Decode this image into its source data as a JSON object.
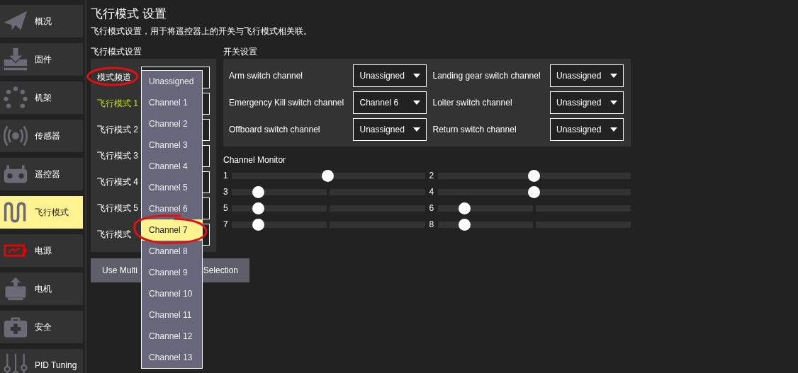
{
  "sidebar": {
    "items": [
      {
        "label": "概况",
        "selected": false
      },
      {
        "label": "固件",
        "selected": false
      },
      {
        "label": "机架",
        "selected": false
      },
      {
        "label": "传感器",
        "selected": false
      },
      {
        "label": "遥控器",
        "selected": false
      },
      {
        "label": "飞行模式",
        "selected": true
      },
      {
        "label": "电源",
        "selected": false
      },
      {
        "label": "电机",
        "selected": false
      },
      {
        "label": "安全",
        "selected": false
      },
      {
        "label": "PID Tuning",
        "selected": false
      }
    ]
  },
  "page": {
    "title": "飞行模式 设置",
    "description": "飞行模式设置，用于将遥控器上的开关与飞行模式相关联。"
  },
  "flight_modes": {
    "heading": "飞行模式设置",
    "mode_channel": {
      "label": "模式频道",
      "circled": true
    },
    "modes": [
      {
        "label": "飞行模式 1",
        "active": true
      },
      {
        "label": "飞行模式 2",
        "active": false
      },
      {
        "label": "飞行模式 3",
        "active": false
      },
      {
        "label": "飞行模式 4",
        "active": false
      },
      {
        "label": "飞行模式 5",
        "active": false
      },
      {
        "label": "飞行模式",
        "active": false
      }
    ]
  },
  "dropdown": {
    "options": [
      {
        "label": "Unassigned",
        "selected": false,
        "circled": false
      },
      {
        "label": "Channel 1",
        "selected": false,
        "circled": false
      },
      {
        "label": "Channel 2",
        "selected": false,
        "circled": false
      },
      {
        "label": "Channel 3",
        "selected": false,
        "circled": false
      },
      {
        "label": "Channel 4",
        "selected": false,
        "circled": false
      },
      {
        "label": "Channel 5",
        "selected": false,
        "circled": false
      },
      {
        "label": "Channel 6",
        "selected": false,
        "circled": false
      },
      {
        "label": "Channel 7",
        "selected": true,
        "circled": true
      },
      {
        "label": "Channel 8",
        "selected": false,
        "circled": false
      },
      {
        "label": "Channel 9",
        "selected": false,
        "circled": false
      },
      {
        "label": "Channel 10",
        "selected": false,
        "circled": false
      },
      {
        "label": "Channel 11",
        "selected": false,
        "circled": false
      },
      {
        "label": "Channel 12",
        "selected": false,
        "circled": false
      },
      {
        "label": "Channel 13",
        "selected": false,
        "circled": false
      }
    ]
  },
  "switches": {
    "heading": "开关设置",
    "rows": [
      {
        "label": "Arm switch channel",
        "value": "Unassigned"
      },
      {
        "label": "Landing gear switch channel",
        "value": "Unassigned"
      },
      {
        "label": "Emergency Kill switch channel",
        "value": "Channel 6"
      },
      {
        "label": "Loiter switch channel",
        "value": "Unassigned"
      },
      {
        "label": "Offboard switch channel",
        "value": "Unassigned"
      },
      {
        "label": "Return switch channel",
        "value": "Unassigned"
      }
    ]
  },
  "monitor": {
    "title": "Channel Monitor",
    "channels": [
      {
        "label": "1",
        "level": 0.5
      },
      {
        "label": "2",
        "level": 0.5
      },
      {
        "label": "3",
        "level": 0.14
      },
      {
        "label": "4",
        "level": 0.5
      },
      {
        "label": "5",
        "level": 0.14
      },
      {
        "label": "6",
        "level": 0.14
      },
      {
        "label": "7",
        "level": 0.14
      },
      {
        "label": "8",
        "level": 0.14
      }
    ]
  },
  "button": {
    "label_start": "Use Multi",
    "label_end": "Selection"
  }
}
